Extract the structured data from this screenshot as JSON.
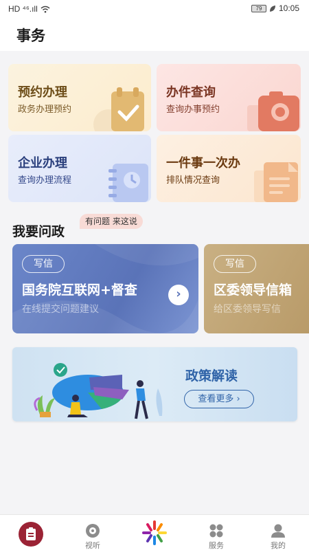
{
  "status_bar": {
    "left": "HD ⁴⁶.ıll",
    "battery": "79",
    "time": "10:05"
  },
  "header": {
    "title": "事务"
  },
  "services": [
    {
      "title": "预约办理",
      "subtitle": "政务办理预约",
      "icon": "calendar-check-icon"
    },
    {
      "title": "办件查询",
      "subtitle": "查询办事预约",
      "icon": "camera-search-icon"
    },
    {
      "title": "企业办理",
      "subtitle": "查询办理流程",
      "icon": "notebook-icon"
    },
    {
      "title": "一件事一次办",
      "subtitle": "排队情况查询",
      "icon": "document-icon"
    }
  ],
  "section": {
    "title": "我要问政",
    "tag": "有问题 来这说"
  },
  "banners": [
    {
      "chip": "写信",
      "title": "国务院互联网+督查",
      "subtitle": "在线提交问题建议"
    },
    {
      "chip": "写信",
      "title": "区委领导信箱",
      "subtitle": "给区委领导写信"
    }
  ],
  "policy": {
    "title": "政策解读",
    "button": "查看更多 ›"
  },
  "tabbar": [
    {
      "label": "",
      "icon": "affairs-icon",
      "active": true
    },
    {
      "label": "视听",
      "icon": "play-disc-icon"
    },
    {
      "label": "",
      "icon": "center-logo-icon"
    },
    {
      "label": "服务",
      "icon": "grid-icon"
    },
    {
      "label": "我的",
      "icon": "user-icon"
    }
  ],
  "colors": {
    "brand": "#9b2335",
    "accent": "#2f63a8"
  }
}
